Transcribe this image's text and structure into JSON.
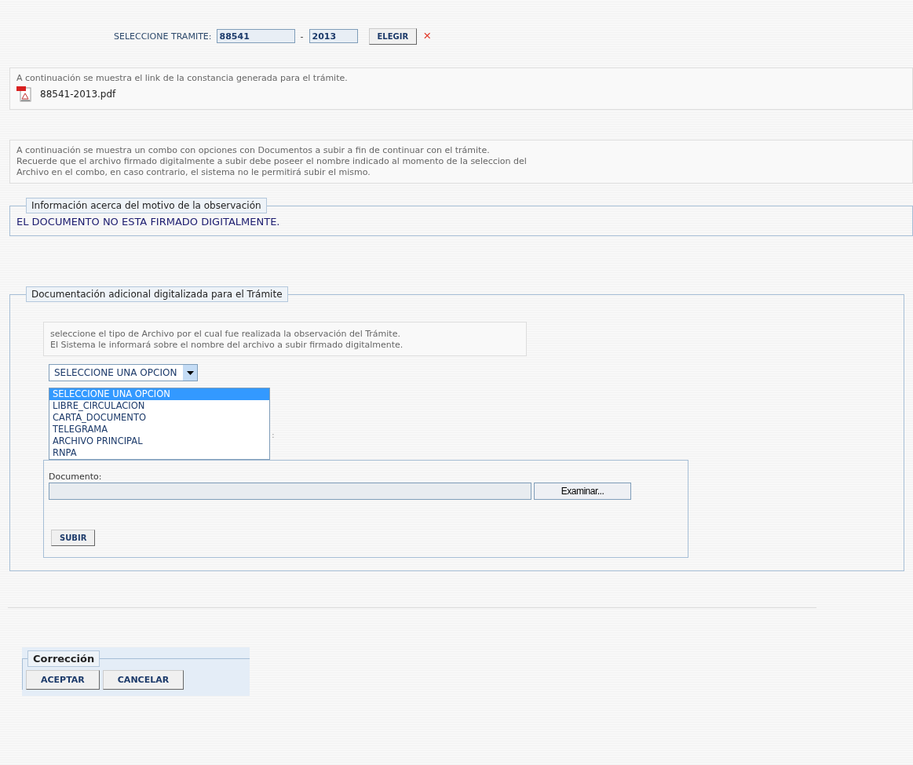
{
  "tramite_selector": {
    "label": "SELECCIONE TRAMITE:",
    "number": "88541",
    "separator": "-",
    "year": "2013",
    "button": "ELEGIR",
    "clear": "×"
  },
  "constancia": {
    "text": "A continuación se muestra el link de la constancia generada para el trámite.",
    "file_link": "88541-2013.pdf"
  },
  "instructions": "A continuación se muestra un combo con opciones con Documentos a subir a fin de continuar con el trámite.\nRecuerde que el archivo firmado digitalmente a subir debe poseer el nombre indicado al momento de la seleccion del\nArchivo en el combo, en caso contrario, el sistema no le permitirá subir el mismo.",
  "observation": {
    "legend": "Información acerca del motivo de la observación",
    "message": "EL DOCUMENTO NO ESTA FIRMADO DIGITALMENTE."
  },
  "additional_docs": {
    "legend": "Documentación adicional digitalizada para el Trámite",
    "hint": "seleccione el tipo de Archivo por el cual fue realizada la observación del Trámite.\nEl Sistema le informará sobre el nombre del archivo a subir firmado digitalmente.",
    "select": {
      "value": "SELECCIONE UNA OPCION",
      "expanded": true,
      "options": [
        {
          "label": "SELECCIONE UNA OPCION",
          "selected": true
        },
        {
          "label": "LIBRE_CIRCULACION",
          "selected": false
        },
        {
          "label": "CARTA_DOCUMENTO",
          "selected": false
        },
        {
          "label": "TELEGRAMA",
          "selected": false
        },
        {
          "label": "ARCHIVO PRINCIPAL",
          "selected": false
        },
        {
          "label": "RNPA",
          "selected": false
        }
      ]
    },
    "hidden_colon": ":",
    "upload": {
      "label": "Documento:",
      "browse_button": "Examinar...",
      "submit_button": "SUBIR"
    }
  },
  "correction": {
    "legend": "Corrección",
    "buttons": [
      "ACEPTAR",
      "CANCELAR"
    ]
  }
}
